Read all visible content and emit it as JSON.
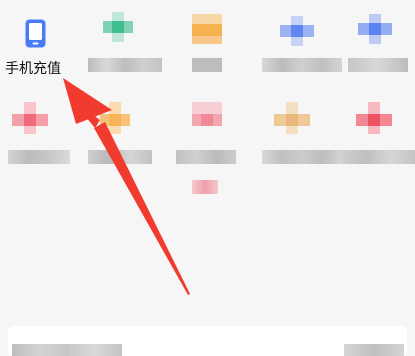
{
  "shortcut": {
    "label": "手机充值",
    "icon": "phone-icon",
    "icon_color": "#3d6ff5"
  },
  "annotation": {
    "type": "arrow",
    "color": "#f23b2f",
    "target": "手机充值"
  },
  "blurred_shortcuts": [
    {
      "id": "green",
      "accent": "#3fbf8f"
    },
    {
      "id": "orange",
      "accent": "#f5b24f"
    },
    {
      "id": "blue-1",
      "accent": "#5f86ef"
    },
    {
      "id": "blue-2",
      "accent": "#5b82f0"
    },
    {
      "id": "red-1",
      "accent": "#f06a7a"
    },
    {
      "id": "orange-2",
      "accent": "#f7b457"
    },
    {
      "id": "pink",
      "accent": "#f08a98"
    },
    {
      "id": "tan",
      "accent": "#e8b97a"
    },
    {
      "id": "red-2",
      "accent": "#ee5363"
    }
  ]
}
